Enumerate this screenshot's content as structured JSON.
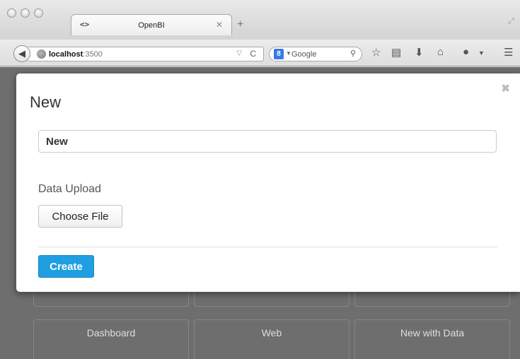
{
  "browser": {
    "tab_title": "OpenBI",
    "tab_favicon": "<>",
    "url_host": "localhost",
    "url_port": ":3500",
    "search_placeholder": "Google",
    "search_engine_glyph": "8"
  },
  "modal": {
    "title": "New",
    "name_value": "New",
    "upload_label": "Data Upload",
    "choose_file_label": "Choose File",
    "create_label": "Create",
    "close_glyph": "✖"
  },
  "background_tiles": [
    {
      "label": ""
    },
    {
      "label": ""
    },
    {
      "label": ""
    },
    {
      "label": "Dashboard"
    },
    {
      "label": "Web"
    },
    {
      "label": "New with Data"
    }
  ],
  "colors": {
    "primary_button": "#1f9ee1",
    "overlay": "#6e6e6e"
  }
}
